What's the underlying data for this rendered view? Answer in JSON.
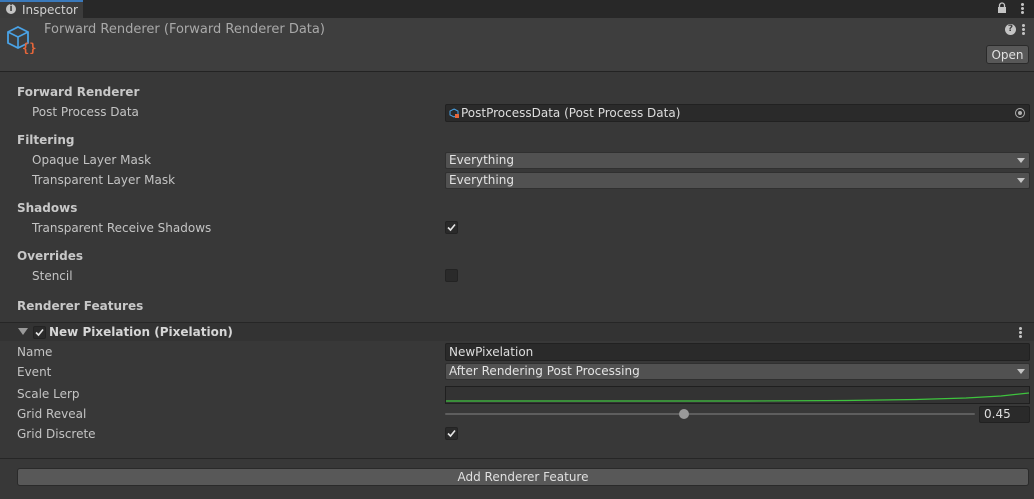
{
  "tab": {
    "label": "Inspector",
    "icon": "info-icon"
  },
  "header": {
    "title": "Forward Renderer (Forward Renderer Data)",
    "open_label": "Open",
    "help_icon": "help-icon",
    "menu_icon": "kebab-menu-icon"
  },
  "sections": {
    "forward_renderer": {
      "title": "Forward Renderer",
      "post_process_label": "Post Process Data",
      "post_process_value": "PostProcessData (Post Process Data)"
    },
    "filtering": {
      "title": "Filtering",
      "opaque_label": "Opaque Layer Mask",
      "opaque_value": "Everything",
      "transparent_label": "Transparent Layer Mask",
      "transparent_value": "Everything"
    },
    "shadows": {
      "title": "Shadows",
      "receive_label": "Transparent Receive Shadows",
      "receive_checked": true
    },
    "overrides": {
      "title": "Overrides",
      "stencil_label": "Stencil",
      "stencil_checked": false
    },
    "renderer_features": {
      "title": "Renderer Features"
    }
  },
  "feature": {
    "title": "New Pixelation (Pixelation)",
    "enabled": true,
    "name_label": "Name",
    "name_value": "NewPixelation",
    "event_label": "Event",
    "event_value": "After Rendering Post Processing",
    "scale_lerp_label": "Scale Lerp",
    "grid_reveal_label": "Grid Reveal",
    "grid_reveal_value": "0.45",
    "grid_discrete_label": "Grid Discrete",
    "grid_discrete_checked": true
  },
  "footer": {
    "add_label": "Add Renderer Feature"
  },
  "colors": {
    "accent": "#3a79bb",
    "curve": "#3ec43e",
    "background": "#383838"
  }
}
